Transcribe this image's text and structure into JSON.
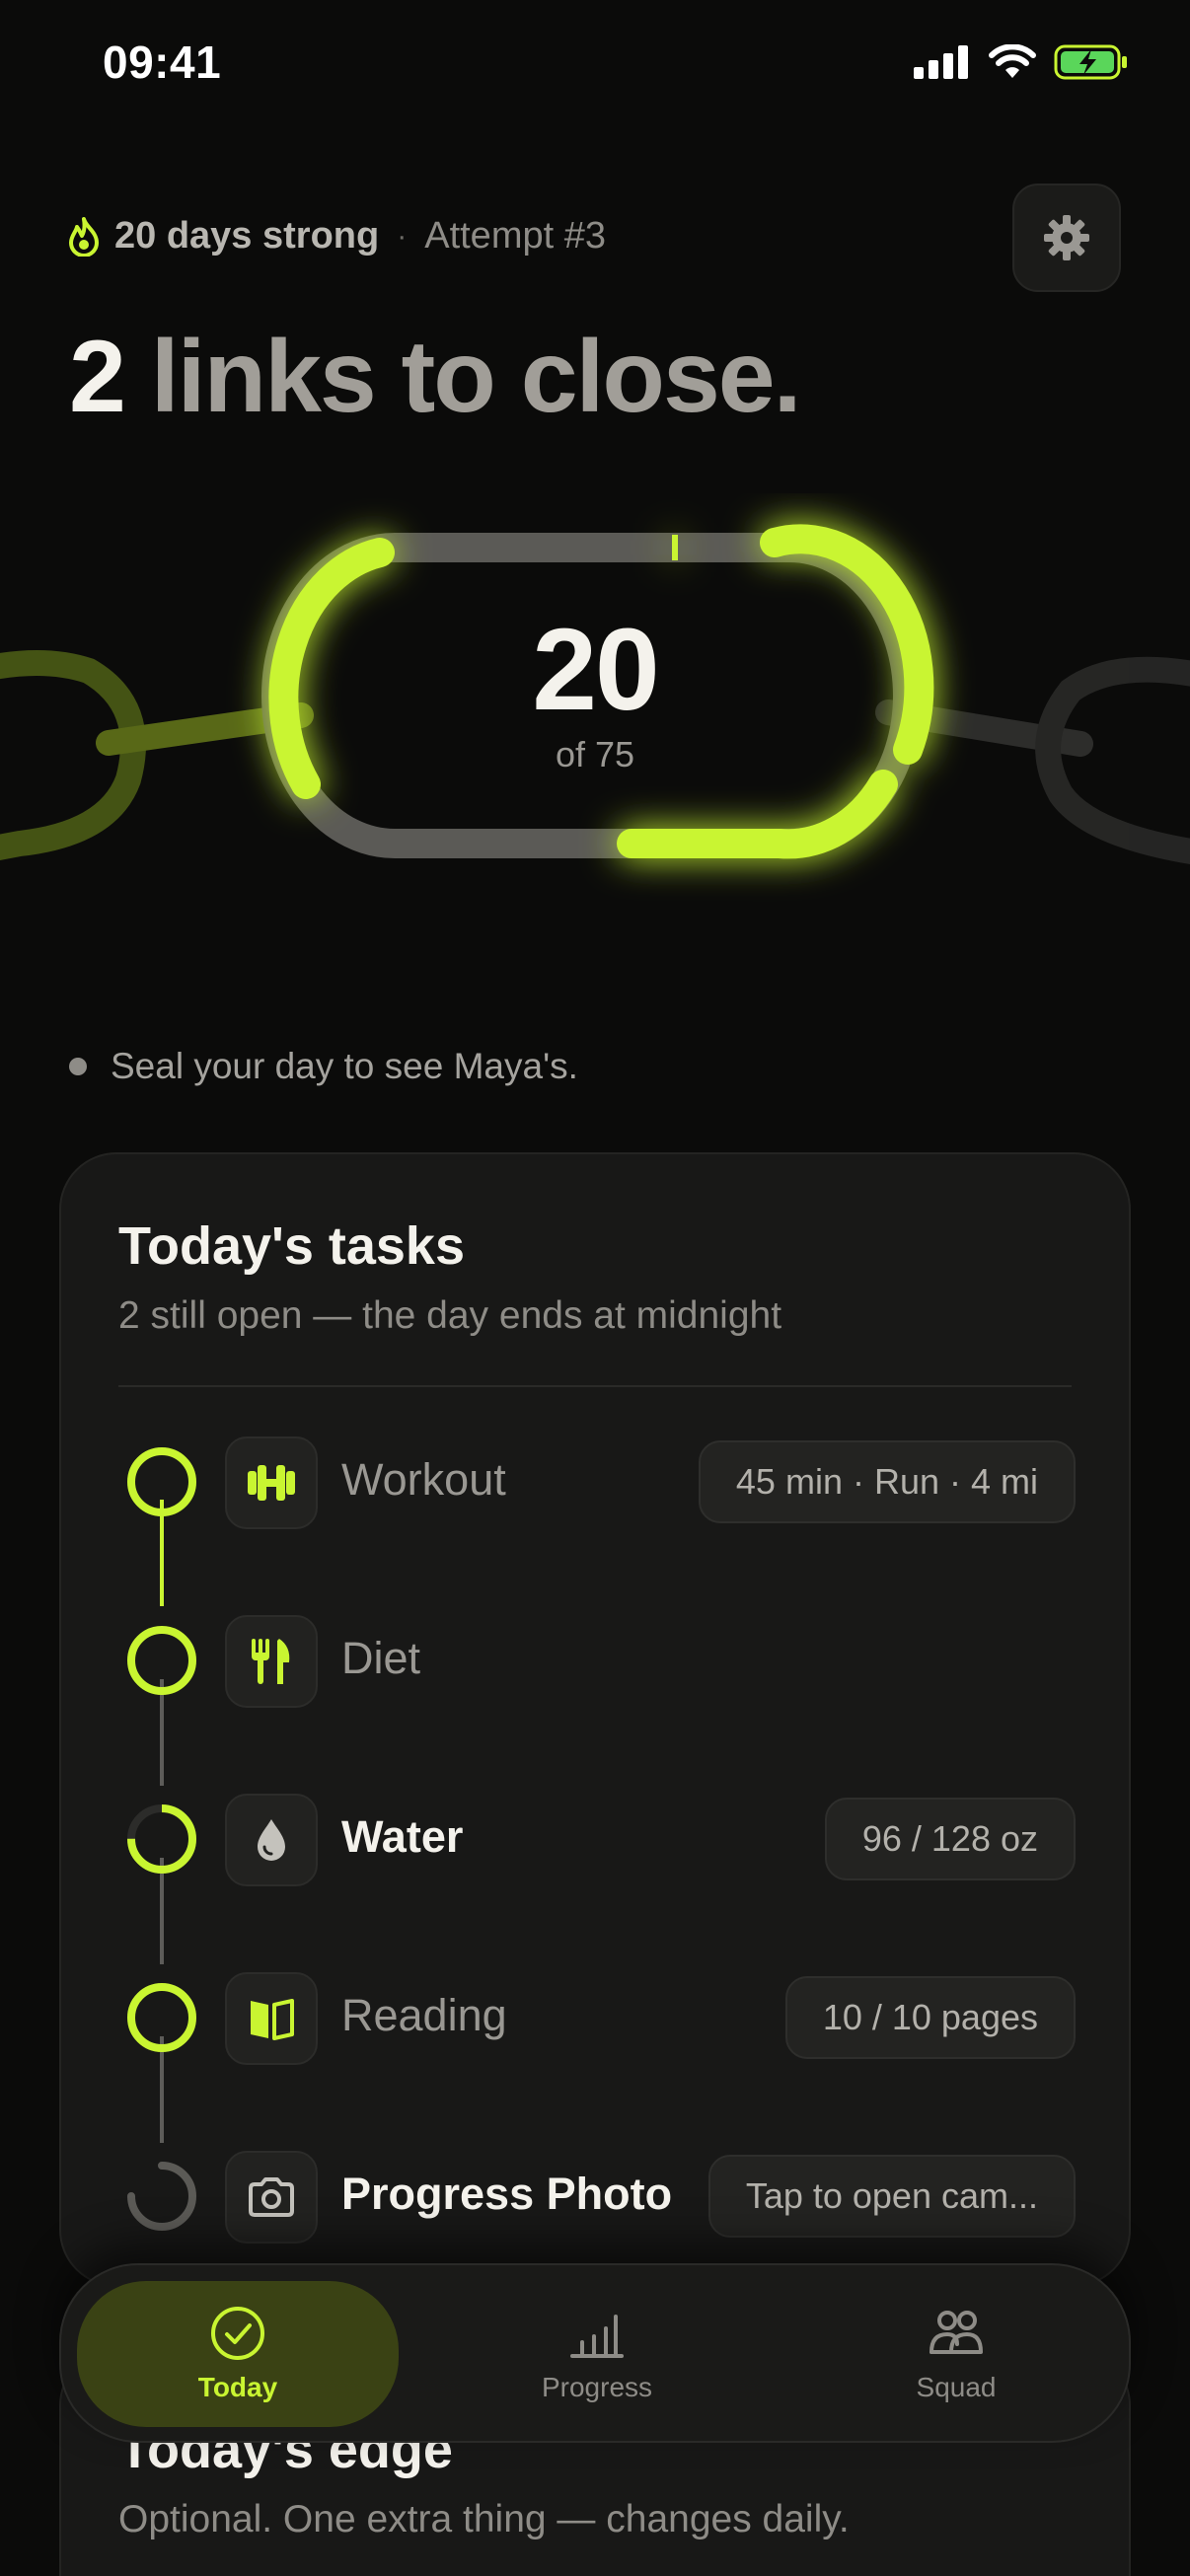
{
  "status_bar": {
    "time": "09:41"
  },
  "header": {
    "streak": "20 days strong",
    "separator": "·",
    "attempt": "Attempt #3",
    "headline_number": "2",
    "headline_rest": "links to close."
  },
  "counter": {
    "current": "20",
    "total": "of 75"
  },
  "hint": "Seal your day to see Maya's.",
  "tasks_card": {
    "title": "Today's tasks",
    "subtitle": "2 still open — the day ends at midnight",
    "tasks": [
      {
        "label": "Workout",
        "chip": "45 min · Run · 4 mi",
        "state": "done",
        "icon": "dumbbell-icon"
      },
      {
        "label": "Diet",
        "chip": "",
        "state": "done",
        "icon": "fork-knife-icon"
      },
      {
        "label": "Water",
        "chip": "96 / 128 oz",
        "state": "partial",
        "icon": "water-drop-icon",
        "progress": 0.75
      },
      {
        "label": "Reading",
        "chip": "10 / 10 pages",
        "state": "done",
        "icon": "book-icon"
      },
      {
        "label": "Progress Photo",
        "chip": "Tap to open cam...",
        "state": "open",
        "icon": "camera-icon"
      }
    ]
  },
  "edge_card": {
    "title": "Today's edge",
    "subtitle": "Optional. One extra thing — changes daily."
  },
  "nav": {
    "items": [
      {
        "label": "Today",
        "icon": "check-circle-icon",
        "active": true
      },
      {
        "label": "Progress",
        "icon": "bar-chart-icon",
        "active": false
      },
      {
        "label": "Squad",
        "icon": "people-icon",
        "active": false
      }
    ]
  },
  "colors": {
    "accent": "#c9f531",
    "background": "#0b0b0a",
    "card": "#181817"
  }
}
